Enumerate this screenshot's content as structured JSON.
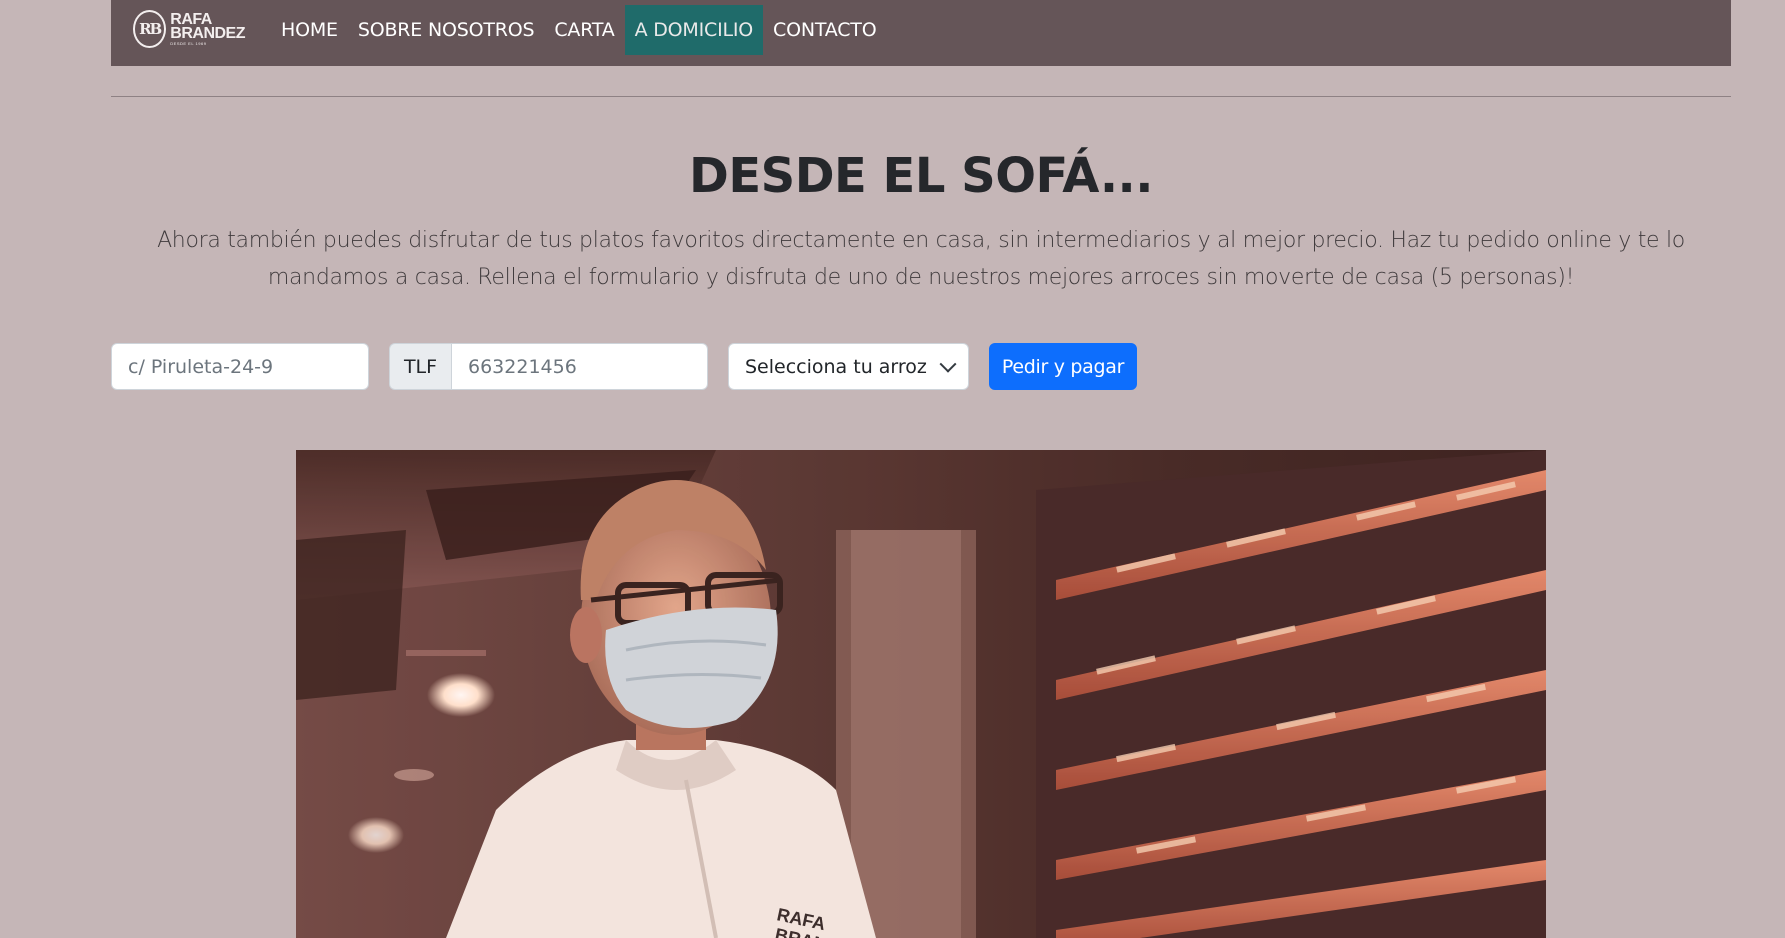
{
  "brand": {
    "monogram": "RB",
    "name_line1": "RAFA",
    "name_line2": "BRANDEZ",
    "tagline": "DESDE EL 1969"
  },
  "nav": {
    "items": [
      {
        "label": "HOME"
      },
      {
        "label": "SOBRE NOSOTROS"
      },
      {
        "label": "CARTA"
      },
      {
        "label": "A DOMICILIO",
        "active": true
      },
      {
        "label": "CONTACTO"
      }
    ]
  },
  "hero": {
    "title": "DESDE EL SOFÁ...",
    "text": "Ahora también puedes disfrutar de tus platos favoritos directamente en casa, sin intermediarios y al mejor precio. Haz tu pedido online y te lo mandamos a casa. Rellena el formulario y disfruta de uno de nuestros mejores arroces sin moverte de casa (5 personas)!"
  },
  "form": {
    "address_placeholder": "c/ Piruleta-24-9",
    "phone_prefix": "TLF",
    "phone_placeholder": "663221456",
    "select_value": "Selecciona tu arroz",
    "submit_label": "Pedir y pagar"
  },
  "photo": {
    "chef_jacket_text_line1": "RAFA",
    "chef_jacket_text_line2": "BRANDEZ"
  },
  "colors": {
    "page_bg": "#c5b6b7",
    "navbar_bg": "#655558",
    "nav_active_bg": "#1f6b6a",
    "primary": "#0d6efd"
  }
}
